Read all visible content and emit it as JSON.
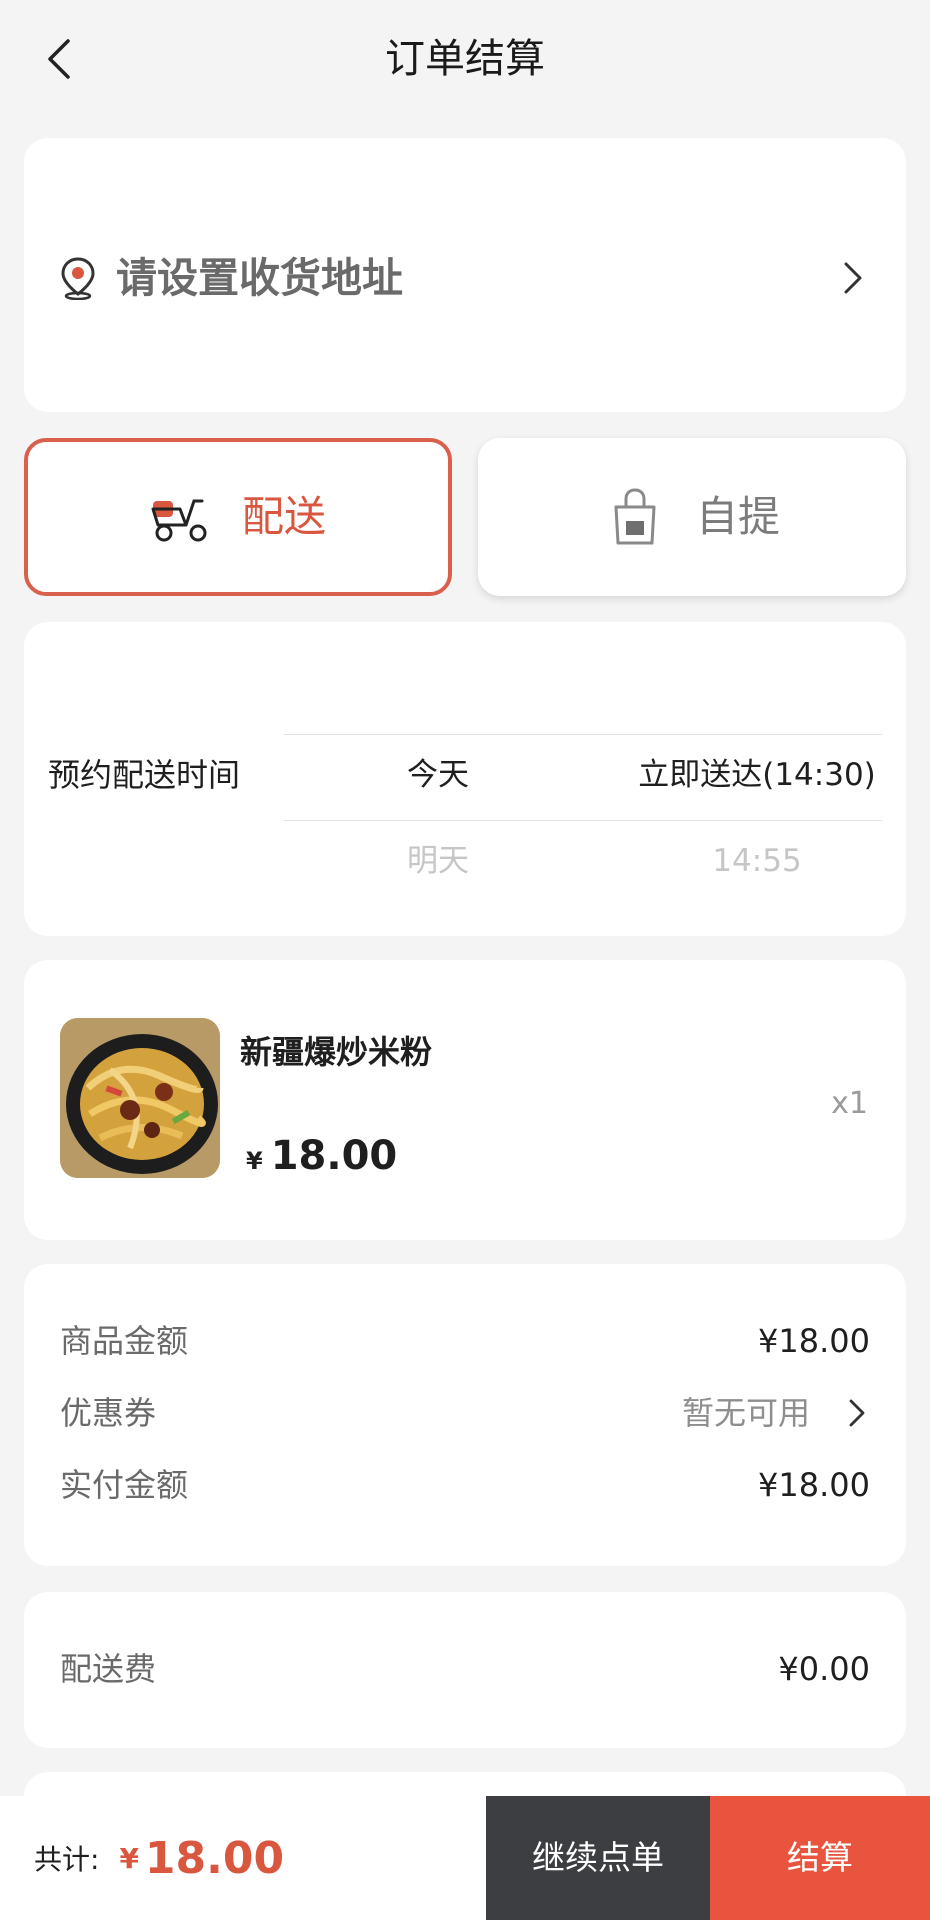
{
  "header": {
    "title": "订单结算",
    "back_icon": "chevron-left-icon"
  },
  "address": {
    "placeholder": "请设置收货地址",
    "icon": "location-pin-icon"
  },
  "delivery_mode": {
    "options": [
      {
        "label": "配送",
        "icon": "scooter-icon",
        "selected": true
      },
      {
        "label": "自提",
        "icon": "shopping-bag-icon",
        "selected": false
      }
    ],
    "accent_color": "#d9573f"
  },
  "schedule": {
    "label": "预约配送时间",
    "days": [
      "今天",
      "明天"
    ],
    "times": [
      "立即送达(14:30)",
      "14:55"
    ]
  },
  "product": {
    "name": "新疆爆炒米粉",
    "currency": "¥",
    "price": "18.00",
    "quantity": "x1"
  },
  "summary": {
    "goods_label": "商品金额",
    "goods_value": "¥18.00",
    "coupon_label": "优惠券",
    "coupon_value": "暂无可用",
    "paid_label": "实付金额",
    "paid_value": "¥18.00"
  },
  "fee": {
    "label": "配送费",
    "value": "¥0.00"
  },
  "bottom_bar": {
    "total_label": "共计:",
    "currency": "¥",
    "total_amount": "18.00",
    "continue_label": "继续点单",
    "checkout_label": "结算",
    "checkout_color": "#e8543d",
    "continue_color": "#3d3e41"
  }
}
